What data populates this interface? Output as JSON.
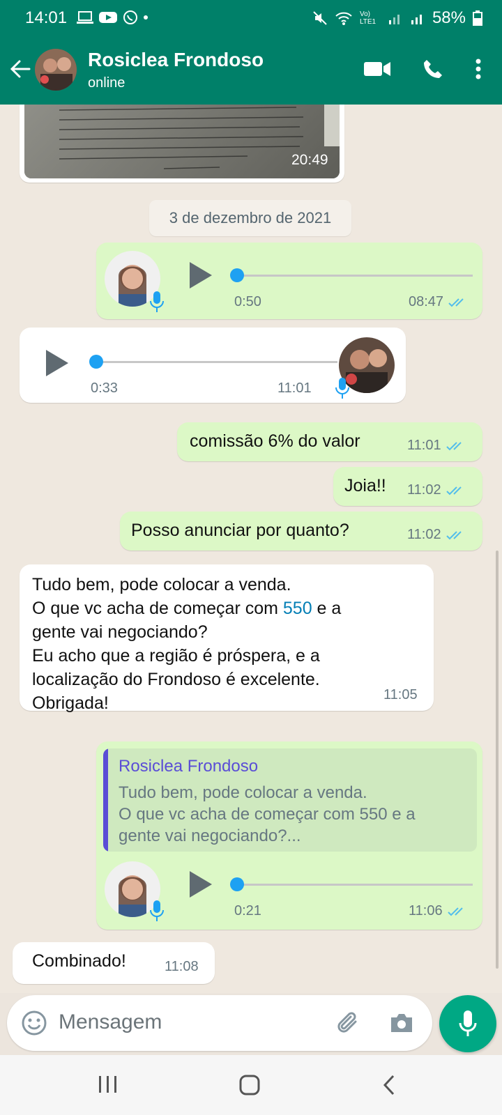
{
  "status_bar": {
    "time": "14:01",
    "battery": "58%",
    "network": "Vo) LTE1"
  },
  "header": {
    "contact_name": "Rosiclea Frondoso",
    "presence": "online",
    "icons": [
      "back-arrow-icon",
      "video-call-icon",
      "phone-call-icon",
      "more-vert-icon"
    ]
  },
  "chat": {
    "doc_timestamp": "20:49",
    "date_separator": "3 de dezembro de 2021",
    "messages": [
      {
        "type": "voice",
        "dir": "out",
        "duration": "0:50",
        "time": "08:47"
      },
      {
        "type": "voice",
        "dir": "in",
        "duration": "0:33",
        "time": "11:01"
      },
      {
        "type": "text",
        "dir": "out",
        "text": "comissão 6% do valor",
        "time": "11:01"
      },
      {
        "type": "text",
        "dir": "out",
        "text": "Joia!!",
        "time": "11:02"
      },
      {
        "type": "text",
        "dir": "out",
        "text": "Posso anunciar por quanto?",
        "time": "11:02"
      },
      {
        "type": "text",
        "dir": "in",
        "lines": [
          "Tudo bem, pode colocar a venda.",
          "O que vc acha de começar com ",
          "550",
          " e a",
          "gente vai negociando?",
          "Eu acho que a região é próspera, e a",
          "localização do  Frondoso é excelente.",
          "Obrigada!"
        ],
        "time": "11:05"
      },
      {
        "type": "voice-reply",
        "dir": "out",
        "reply_name": "Rosiclea Frondoso",
        "reply_lines": [
          "Tudo bem, pode colocar a venda.",
          "O que vc acha de começar com 550 e a",
          "gente vai negociando?..."
        ],
        "duration": "0:21",
        "time": "11:06"
      },
      {
        "type": "text",
        "dir": "in",
        "text": "Combinado!",
        "time": "11:08"
      }
    ]
  },
  "composer": {
    "placeholder": "Mensagem"
  },
  "colors": {
    "header": "#008069",
    "outgoing": "#dcf8c6",
    "incoming": "#ffffff",
    "accent": "#00a884",
    "read_ticks": "#53bdeb",
    "link_number": "#027eb5"
  }
}
